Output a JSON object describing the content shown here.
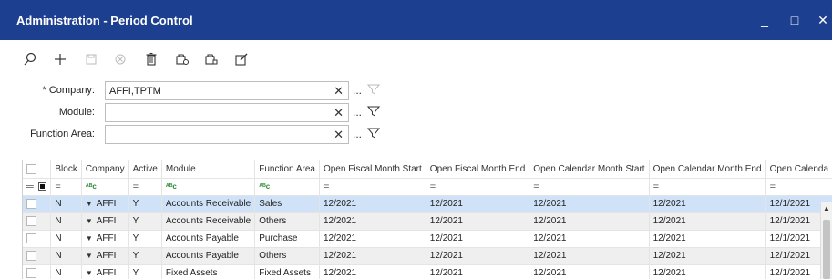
{
  "window": {
    "title": "Administration - Period Control",
    "minimize": "_",
    "maximize": "□",
    "close": "✕"
  },
  "toolbar": {
    "icons": [
      "search-icon",
      "add-icon",
      "save-icon",
      "cancel-icon",
      "delete-icon",
      "copy-icon",
      "paste-icon",
      "edit-icon"
    ]
  },
  "filters": {
    "company": {
      "label": "* Company:",
      "value": "AFFI,TPTM",
      "clear": "✕",
      "ellipsis": "..."
    },
    "module": {
      "label": "Module:",
      "value": "",
      "clear": "✕",
      "ellipsis": "..."
    },
    "function_area": {
      "label": "Function Area:",
      "value": "",
      "clear": "✕",
      "ellipsis": "..."
    }
  },
  "grid": {
    "columns": [
      "",
      "Block",
      "Company",
      "Active",
      "Module",
      "Function Area",
      "Open Fiscal Month Start",
      "Open Fiscal Month End",
      "Open Calendar Month Start",
      "Open Calendar Month End",
      "Open Calenda"
    ],
    "filter_row": [
      "",
      "=",
      "",
      "=",
      "",
      "",
      "=",
      "=",
      "=",
      "=",
      "="
    ],
    "rows": [
      {
        "block": "N",
        "company": "AFFI",
        "active": "Y",
        "module": "Accounts Receivable",
        "function_area": "Sales",
        "fiscal_start": "12/2021",
        "fiscal_end": "12/2021",
        "cal_start": "12/2021",
        "cal_end": "12/2021",
        "open_cal": "12/1/2021"
      },
      {
        "block": "N",
        "company": "AFFI",
        "active": "Y",
        "module": "Accounts Receivable",
        "function_area": "Others",
        "fiscal_start": "12/2021",
        "fiscal_end": "12/2021",
        "cal_start": "12/2021",
        "cal_end": "12/2021",
        "open_cal": "12/1/2021"
      },
      {
        "block": "N",
        "company": "AFFI",
        "active": "Y",
        "module": "Accounts Payable",
        "function_area": "Purchase",
        "fiscal_start": "12/2021",
        "fiscal_end": "12/2021",
        "cal_start": "12/2021",
        "cal_end": "12/2021",
        "open_cal": "12/1/2021"
      },
      {
        "block": "N",
        "company": "AFFI",
        "active": "Y",
        "module": "Accounts Payable",
        "function_area": "Others",
        "fiscal_start": "12/2021",
        "fiscal_end": "12/2021",
        "cal_start": "12/2021",
        "cal_end": "12/2021",
        "open_cal": "12/1/2021"
      },
      {
        "block": "N",
        "company": "AFFI",
        "active": "Y",
        "module": "Fixed Assets",
        "function_area": "Fixed Assets",
        "fiscal_start": "12/2021",
        "fiscal_end": "12/2021",
        "cal_start": "12/2021",
        "cal_end": "12/2021",
        "open_cal": "12/1/2021"
      }
    ]
  },
  "colors": {
    "titlebar": "#1d3f8f",
    "selected_row": "#cfe2f7",
    "alt_row": "#efefef"
  }
}
